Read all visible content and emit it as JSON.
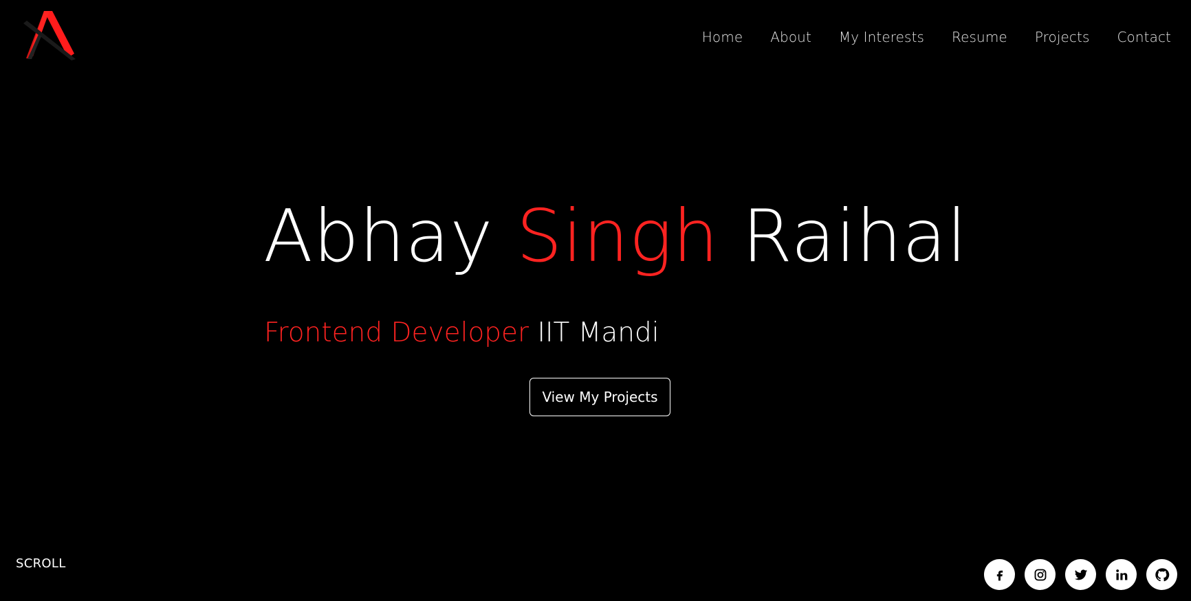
{
  "brand": {
    "logo_icon": "logo-a-icon",
    "accent_color": "#ff2321"
  },
  "nav": {
    "items": [
      {
        "label": "Home"
      },
      {
        "label": "About"
      },
      {
        "label": "My Interests"
      },
      {
        "label": "Resume"
      },
      {
        "label": "Projects"
      },
      {
        "label": "Contact"
      }
    ]
  },
  "hero": {
    "name_first": "Abhay",
    "name_middle": "Singh",
    "name_last": "Raihal",
    "role": "Frontend Developer",
    "institution": "IIT Mandi",
    "cta_label": "View My Projects"
  },
  "footer": {
    "scroll_label": "SCROLL",
    "socials": [
      {
        "icon": "facebook-icon"
      },
      {
        "icon": "instagram-icon"
      },
      {
        "icon": "twitter-icon"
      },
      {
        "icon": "linkedin-icon"
      },
      {
        "icon": "github-icon"
      }
    ]
  },
  "colors": {
    "background": "#000000",
    "text": "#ffffff",
    "nav_text": "#e4e4e4",
    "accent": "#ff2321"
  }
}
